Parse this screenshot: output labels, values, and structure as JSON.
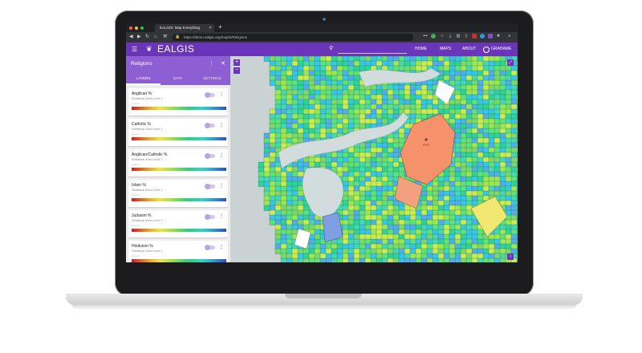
{
  "browser": {
    "tab_title": "EALGIS: Map Everything",
    "url": "https://demo.ealgis.org/map/2/Religions",
    "traffic_light_colors": [
      "#ff5f57",
      "#febc2e",
      "#28c840"
    ]
  },
  "app": {
    "brand": "EALGIS",
    "nav": {
      "home": "HOME",
      "maps": "MAPS",
      "about": "ABOUT",
      "user": "GRAHAME"
    },
    "accent_color": "#6a35b8",
    "panel_color": "#8e5ed3"
  },
  "sidebar": {
    "title": "Religions",
    "tabs": [
      "LAYERS",
      "DATA",
      "SETTINGS"
    ],
    "active_tab": "LAYERS",
    "layers": [
      {
        "title": "Anglican %",
        "subtitle": "Statistical Area Level 1",
        "legend": "Legend"
      },
      {
        "title": "Catholic %",
        "subtitle": "Statistical Area Level 1",
        "legend": "Legend"
      },
      {
        "title": "Anglican/Catholic %",
        "subtitle": "Statistical Area Level 1",
        "legend": "Legend"
      },
      {
        "title": "Islam %",
        "subtitle": "Statistical Area Level 1",
        "legend": "Legend"
      },
      {
        "title": "Judaism %",
        "subtitle": "Statistical Area Level 1",
        "legend": "Legend"
      },
      {
        "title": "Hinduism %",
        "subtitle": "Statistical Area Level 1",
        "legend": "Legend"
      }
    ]
  },
  "map": {
    "zoom_in": "+",
    "zoom_out": "−",
    "marker_label": "PER",
    "land_colors": [
      "#5ee27a",
      "#44d8b4",
      "#9be855",
      "#37c7e6",
      "#7ad96a",
      "#2fd39a",
      "#c8ec52",
      "#4fb0e8"
    ],
    "water_color": "#c9d3d3"
  }
}
